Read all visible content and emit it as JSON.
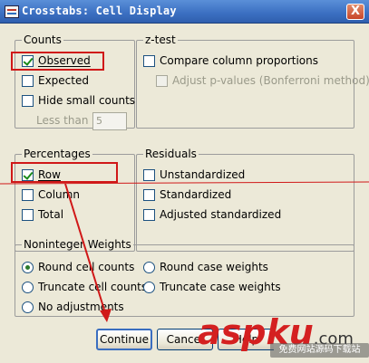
{
  "window": {
    "title": "Crosstabs: Cell Display",
    "close_glyph": "X"
  },
  "counts": {
    "legend": "Counts",
    "observed": {
      "label": "Observed",
      "checked": true
    },
    "expected": {
      "label": "Expected",
      "checked": false
    },
    "hide_small": {
      "label": "Hide small counts",
      "checked": false
    },
    "less_than_label": "Less than",
    "less_than_value": "5"
  },
  "ztest": {
    "legend": "z-test",
    "compare": {
      "label": "Compare column proportions",
      "checked": false
    },
    "adjust": {
      "label": "Adjust p-values (Bonferroni method)",
      "checked": false,
      "enabled": false
    }
  },
  "percentages": {
    "legend": "Percentages",
    "row": {
      "label": "Row",
      "checked": true
    },
    "column": {
      "label": "Column",
      "checked": false
    },
    "total": {
      "label": "Total",
      "checked": false
    }
  },
  "residuals": {
    "legend": "Residuals",
    "unstandardized": {
      "label": "Unstandardized",
      "checked": false
    },
    "standardized": {
      "label": "Standardized",
      "checked": false
    },
    "adjusted": {
      "label": "Adjusted standardized",
      "checked": false
    }
  },
  "noninteger": {
    "legend": "Noninteger Weights",
    "options": {
      "round_cell": "Round cell counts",
      "round_case": "Round case weights",
      "truncate_cell": "Truncate cell counts",
      "truncate_case": "Truncate case weights",
      "no_adjust": "No adjustments"
    },
    "selected": "round_cell"
  },
  "buttons": {
    "continue": "Continue",
    "cancel": "Cancel",
    "help": "Help"
  },
  "watermark": {
    "brand": "aspku",
    "suffix": ".com",
    "tagline": "免费网站源码下载站"
  },
  "colors": {
    "annotation_red": "#d01818",
    "title_blue": "#3b6fc1"
  }
}
